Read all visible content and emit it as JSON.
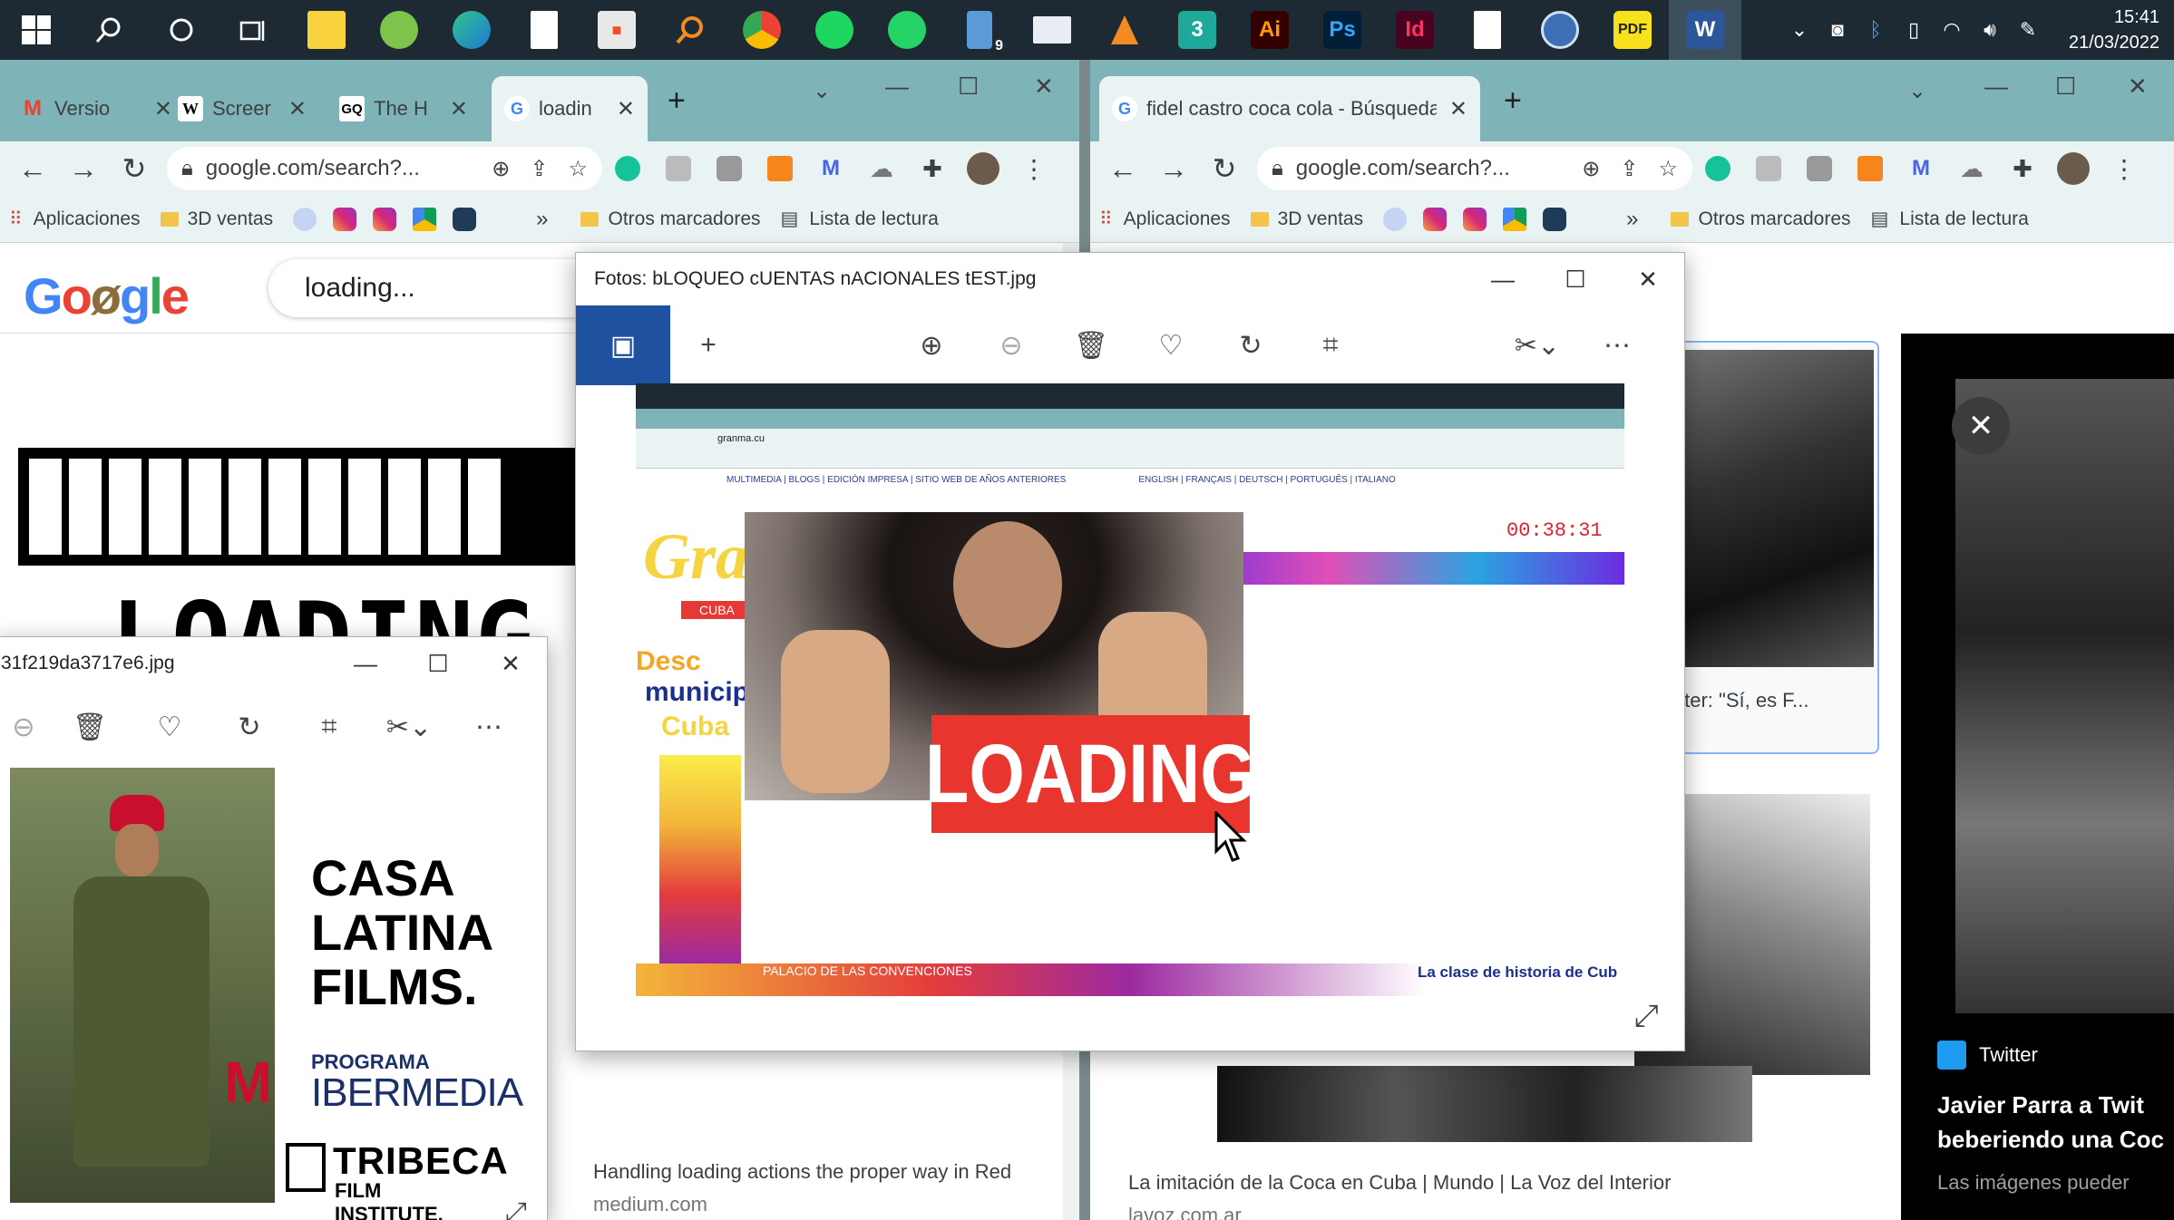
{
  "taskbar": {
    "icons": [
      "windows-start",
      "search",
      "cortana",
      "task-view",
      "sticky-notes",
      "clover",
      "edge",
      "notepad",
      "store",
      "search-orange",
      "chrome",
      "spotify",
      "whatsapp",
      "phone-9",
      "remote",
      "vlc",
      "3",
      "Ai",
      "Ps",
      "Id",
      "file",
      "browser",
      "pdf",
      "W"
    ],
    "badge": "9",
    "time": "15:41",
    "date": "21/03/2022"
  },
  "left_chrome": {
    "tabs": [
      {
        "label": "Versio",
        "icon": "M"
      },
      {
        "label": "Screer",
        "icon": "W"
      },
      {
        "label": "The H",
        "icon": "GQ"
      },
      {
        "label": "loadin",
        "icon": "G"
      }
    ],
    "url": "google.com/search?...",
    "bookmarks": {
      "apps": "Aplicaciones",
      "folder1": "3D ventas",
      "more": "»",
      "other": "Otros marcadores",
      "reading": "Lista de lectura"
    },
    "search_value": "loading...",
    "loading_text": "LOADING",
    "result_title": "Handling loading actions the proper way in Red",
    "result_source": "medium.com"
  },
  "right_chrome": {
    "tab_label": "fidel castro coca cola - Búsqueda",
    "url": "google.com/search?...",
    "bookmarks": {
      "apps": "Aplicaciones",
      "folder1": "3D ventas",
      "more": "»",
      "other": "Otros marcadores",
      "reading": "Lista de lectura"
    },
    "twitter_caption": "Twitter: \"Sí, es F...",
    "result_title": "La imitación de la Coca en Cuba | Mundo | La Voz del Interior",
    "result_source": "lavoz.com.ar",
    "panel_source": "Twitter",
    "panel_title_1": "Javier Parra a Twit",
    "panel_title_2": "beberiendo una Coc",
    "panel_more": "Las imágenes pueder"
  },
  "photos_main": {
    "title": "Fotos: bLOQUEO cUENTAS nACIONALES tEST.jpg",
    "loading_label": "LOADING",
    "inner_left_text": "Desc",
    "inner_left_text2": "municip",
    "inner_left_text3": "Cuba",
    "inner_header": "Gra",
    "inner_timer": "00:38:31",
    "inner_footer": "La clase de historia de Cub",
    "inner_url": "granma.cu",
    "inner_nav": "MULTIMEDIA | BLOGS | EDICIÓN IMPRESA | SITIO WEB DE AÑOS ANTERIORES",
    "inner_lang": "ENGLISH | FRANÇAIS | DEUTSCH | PORTUGUÊS | ITALIANO",
    "inner_tab": "CUBA",
    "inner_bottom": "PALACIO DE LAS CONVENCIONES"
  },
  "photos_small": {
    "title": "31f219da3717e6.jpg",
    "poster_line1": "CASA",
    "poster_line2": "LATINA",
    "poster_line3": "FILMS.",
    "program_label": "PROGRAMA",
    "ibermedia": "IBERMEDIA",
    "tribeca": "TRIBECA",
    "tribeca_sub": "FILM INSTITUTE."
  }
}
